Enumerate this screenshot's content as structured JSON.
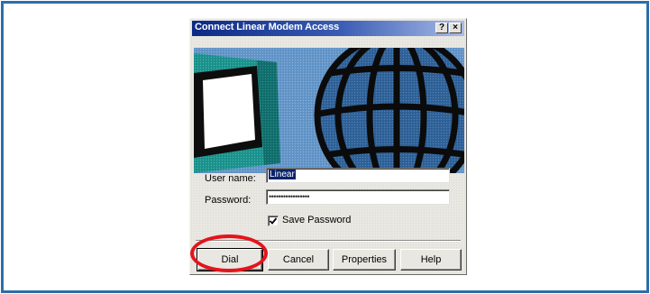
{
  "window": {
    "title": "Connect Linear Modem Access",
    "help_button": "?",
    "close_button": "×"
  },
  "form": {
    "username_label": "User name:",
    "username_value": "Linear",
    "password_label": "Password:",
    "password_value": "•••••••••••••••••",
    "save_password_label": "Save Password",
    "save_password_checked": true
  },
  "buttons": {
    "dial": "Dial",
    "cancel": "Cancel",
    "properties": "Properties",
    "help": "Help"
  },
  "annotation": {
    "highlight_target": "dial-button",
    "highlight_color": "#e4141c"
  },
  "colors": {
    "frame_border": "#2a6fa8",
    "titlebar_start": "#0b2a86",
    "banner_background": "#5a8fc4"
  },
  "icons": {
    "banner": "computer-globe-illustration",
    "check": "checkmark-icon"
  }
}
